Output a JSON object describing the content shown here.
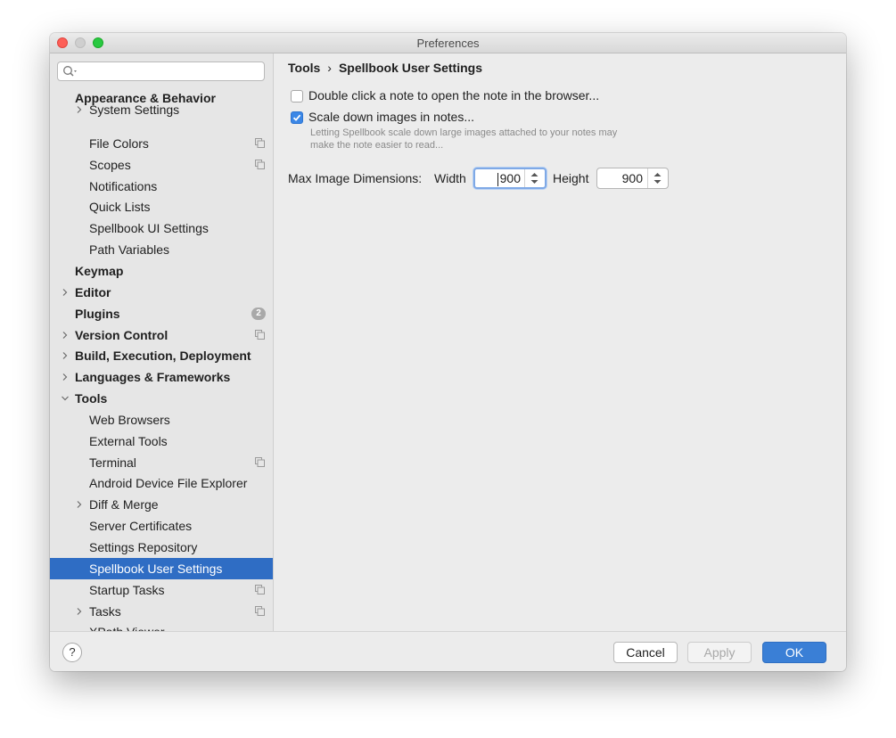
{
  "window": {
    "title": "Preferences"
  },
  "search": {
    "placeholder": ""
  },
  "sidebar": {
    "items": [
      {
        "label": "Appearance & Behavior",
        "bold": true,
        "indent": 0,
        "chevron": "none"
      },
      {
        "label": "System Settings",
        "bold": false,
        "indent": 1,
        "chevron": "right"
      },
      {
        "label": "File Colors",
        "bold": false,
        "indent": 1,
        "chevron": "none",
        "copy_icon": true
      },
      {
        "label": "Scopes",
        "bold": false,
        "indent": 1,
        "chevron": "none",
        "copy_icon": true
      },
      {
        "label": "Notifications",
        "bold": false,
        "indent": 1,
        "chevron": "none"
      },
      {
        "label": "Quick Lists",
        "bold": false,
        "indent": 1,
        "chevron": "none"
      },
      {
        "label": "Spellbook UI Settings",
        "bold": false,
        "indent": 1,
        "chevron": "none"
      },
      {
        "label": "Path Variables",
        "bold": false,
        "indent": 1,
        "chevron": "none"
      },
      {
        "label": "Keymap",
        "bold": true,
        "indent": 0,
        "chevron": "none"
      },
      {
        "label": "Editor",
        "bold": true,
        "indent": 0,
        "chevron": "right"
      },
      {
        "label": "Plugins",
        "bold": true,
        "indent": 0,
        "chevron": "none",
        "badge": "2"
      },
      {
        "label": "Version Control",
        "bold": true,
        "indent": 0,
        "chevron": "right",
        "copy_icon": true
      },
      {
        "label": "Build, Execution, Deployment",
        "bold": true,
        "indent": 0,
        "chevron": "right"
      },
      {
        "label": "Languages & Frameworks",
        "bold": true,
        "indent": 0,
        "chevron": "right"
      },
      {
        "label": "Tools",
        "bold": true,
        "indent": 0,
        "chevron": "down"
      },
      {
        "label": "Web Browsers",
        "bold": false,
        "indent": 1,
        "chevron": "none"
      },
      {
        "label": "External Tools",
        "bold": false,
        "indent": 1,
        "chevron": "none"
      },
      {
        "label": "Terminal",
        "bold": false,
        "indent": 1,
        "chevron": "none",
        "copy_icon": true
      },
      {
        "label": "Android Device File Explorer",
        "bold": false,
        "indent": 1,
        "chevron": "none"
      },
      {
        "label": "Diff & Merge",
        "bold": false,
        "indent": 1,
        "chevron": "right"
      },
      {
        "label": "Server Certificates",
        "bold": false,
        "indent": 1,
        "chevron": "none"
      },
      {
        "label": "Settings Repository",
        "bold": false,
        "indent": 1,
        "chevron": "none"
      },
      {
        "label": "Spellbook User Settings",
        "bold": false,
        "indent": 1,
        "chevron": "none",
        "selected": true
      },
      {
        "label": "Startup Tasks",
        "bold": false,
        "indent": 1,
        "chevron": "none",
        "copy_icon": true
      },
      {
        "label": "Tasks",
        "bold": false,
        "indent": 1,
        "chevron": "right",
        "copy_icon": true
      },
      {
        "label": "XPath Viewer",
        "bold": false,
        "indent": 1,
        "chevron": "none"
      }
    ]
  },
  "breadcrumb": {
    "parent": "Tools",
    "separator": "›",
    "current": "Spellbook User Settings"
  },
  "options": {
    "open_in_browser": {
      "label": "Double click a note to open the note in the browser...",
      "checked": false
    },
    "scale_down": {
      "label": "Scale down images in notes...",
      "checked": true,
      "hint_line1": "Letting Spellbook scale down large images attached to your notes may",
      "hint_line2": "make the note easier to read..."
    }
  },
  "dimensions": {
    "label": "Max Image Dimensions:",
    "width_label": "Width",
    "width_value": "900",
    "height_label": "Height",
    "height_value": "900"
  },
  "footer": {
    "help": "?",
    "cancel": "Cancel",
    "apply": "Apply",
    "ok": "OK"
  },
  "colors": {
    "selection": "#2f6dc4",
    "primary_button": "#3a7fd6",
    "checkbox_checked": "#3b87e6"
  }
}
